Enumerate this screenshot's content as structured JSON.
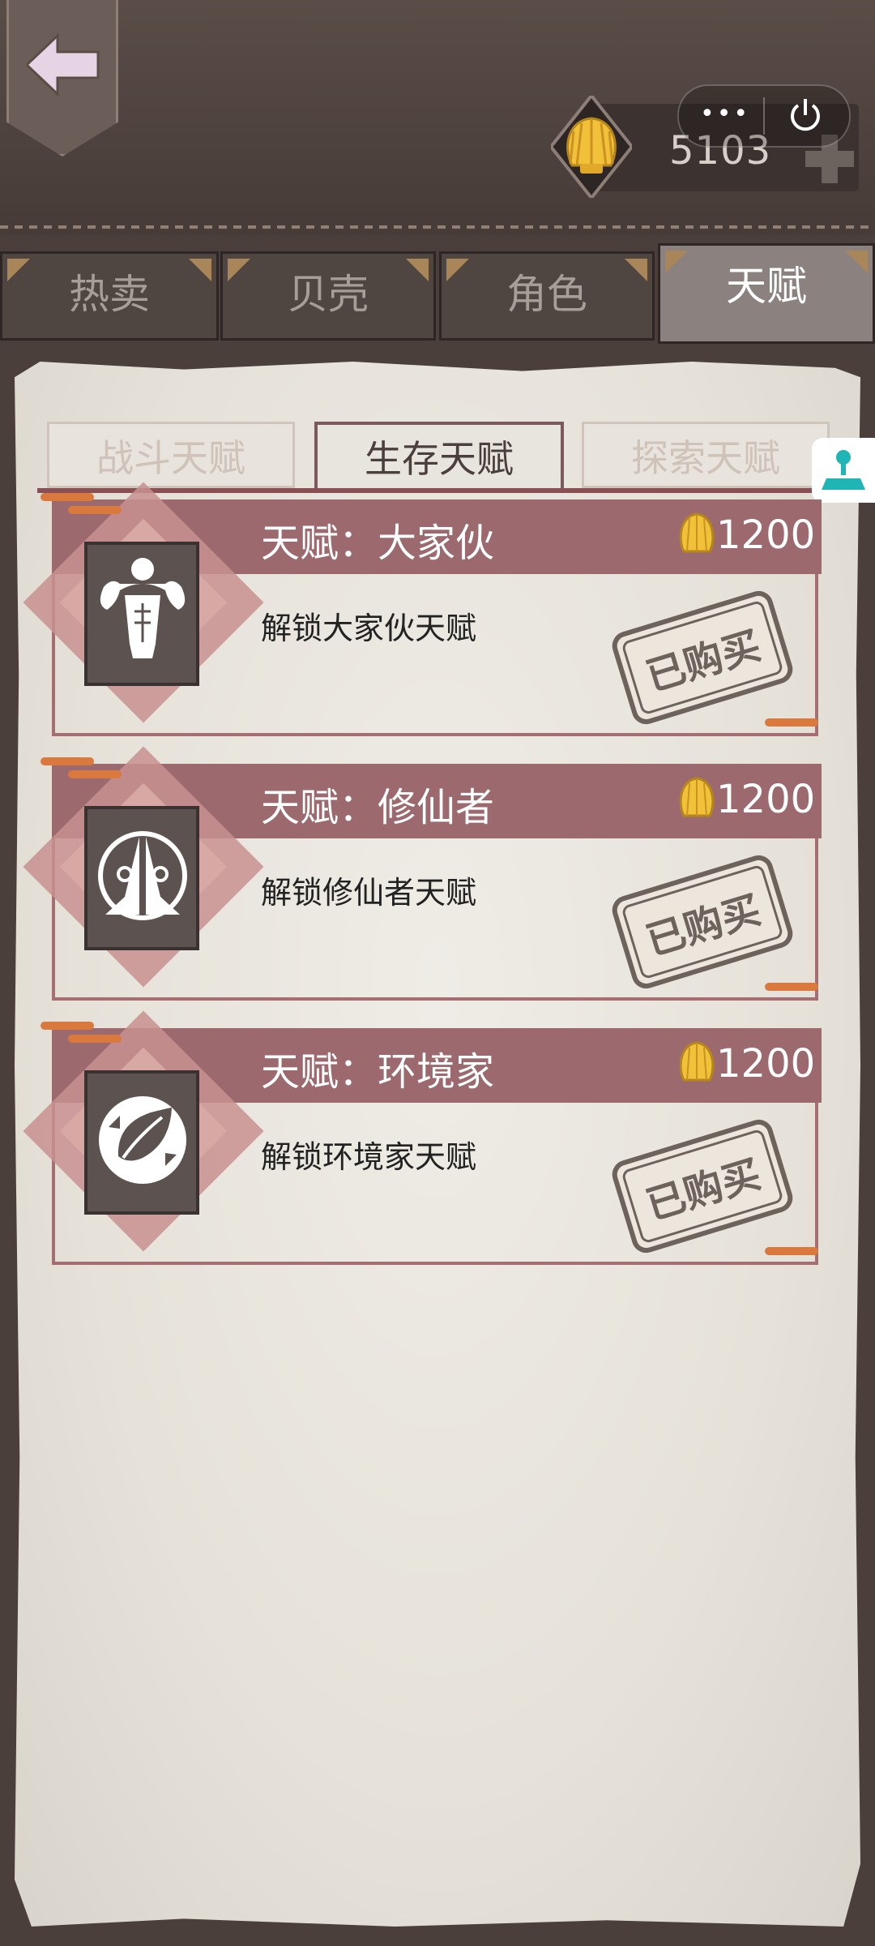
{
  "header": {
    "currency_value": "5103",
    "currency_icon": "shell-icon",
    "back_icon": "back-arrow-icon"
  },
  "tabs": [
    {
      "label": "热卖",
      "active": false
    },
    {
      "label": "贝壳",
      "active": false
    },
    {
      "label": "角色",
      "active": false
    },
    {
      "label": "天赋",
      "active": true
    }
  ],
  "subtabs": [
    {
      "label": "战斗天赋",
      "active": false
    },
    {
      "label": "生存天赋",
      "active": true
    },
    {
      "label": "探索天赋",
      "active": false
    }
  ],
  "talents": [
    {
      "title": "天赋：大家伙",
      "price": "1200",
      "desc": "解锁大家伙天赋",
      "status": "已购买",
      "icon": "muscle-man-icon"
    },
    {
      "title": "天赋：修仙者",
      "price": "1200",
      "desc": "解锁修仙者天赋",
      "status": "已购买",
      "icon": "praying-hands-icon"
    },
    {
      "title": "天赋：环境家",
      "price": "1200",
      "desc": "解锁环境家天赋",
      "status": "已购买",
      "icon": "recycle-leaf-icon"
    }
  ],
  "colors": {
    "accent": "#9c6a6e",
    "tab_active": "#8b8280",
    "paper": "#e8e4de"
  }
}
